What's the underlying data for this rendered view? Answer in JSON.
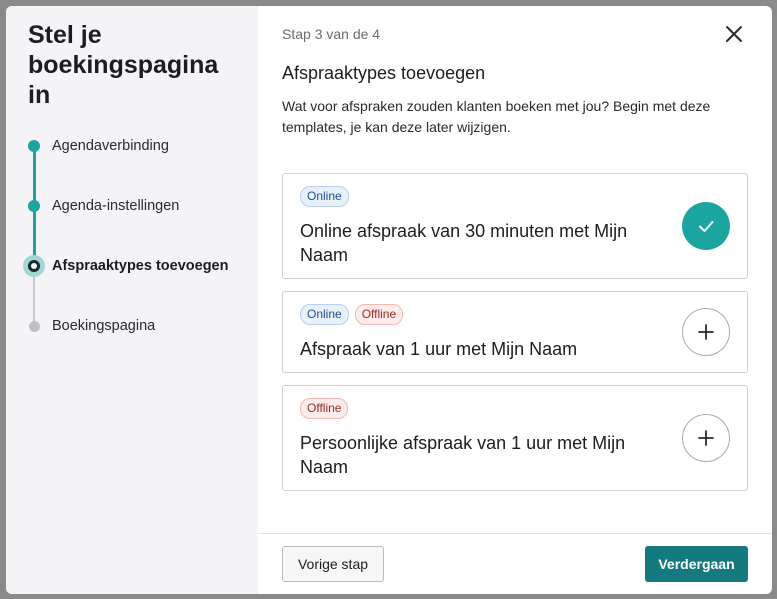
{
  "sidebar": {
    "title": "Stel je boekingspagina in",
    "steps": [
      {
        "label": "Agendaverbinding",
        "state": "done"
      },
      {
        "label": "Agenda-instellingen",
        "state": "done"
      },
      {
        "label": "Afspraaktypes toevoegen",
        "state": "current"
      },
      {
        "label": "Boekingspagina",
        "state": "todo"
      }
    ]
  },
  "main": {
    "step_counter": "Stap 3 van de 4",
    "title": "Afspraaktypes toevoegen",
    "intro": "Wat voor afspraken zouden klanten boeken met jou? Begin met deze templates, je kan deze later wijzigen.",
    "cards": [
      {
        "badges": [
          "Online"
        ],
        "title": "Online afspraak van 30 minuten met Mijn Naam",
        "selected": true
      },
      {
        "badges": [
          "Online",
          "Offline"
        ],
        "title": "Afspraak van 1 uur met Mijn Naam",
        "selected": false
      },
      {
        "badges": [
          "Offline"
        ],
        "title": "Persoonlijke afspraak van 1 uur met Mijn Naam",
        "selected": false
      }
    ]
  },
  "footer": {
    "back_label": "Vorige stap",
    "next_label": "Verdergaan"
  },
  "colors": {
    "accent": "#1aa5a0",
    "primary_button": "#137a7f",
    "online_badge": "#e7f0fb",
    "offline_badge": "#fdeceb"
  }
}
